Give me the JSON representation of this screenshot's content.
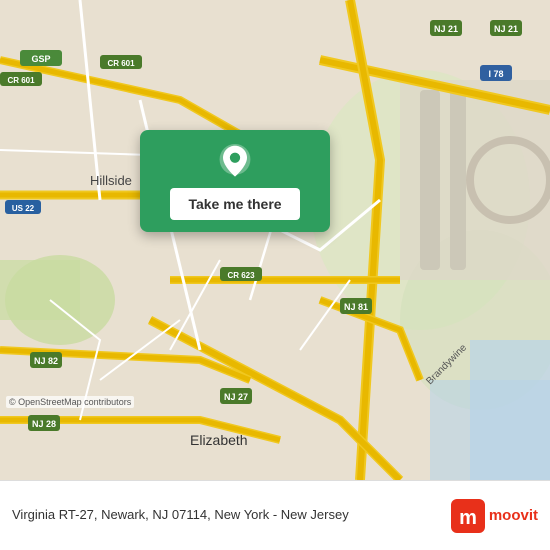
{
  "map": {
    "alt": "Map of Newark NJ area showing highways",
    "osm_credit": "© OpenStreetMap contributors"
  },
  "popup": {
    "button_label": "Take me there",
    "pin_icon": "location-pin"
  },
  "bottom_bar": {
    "address": "Virginia RT-27, Newark, NJ 07114, New York - New Jersey",
    "logo_text": "moovit"
  }
}
